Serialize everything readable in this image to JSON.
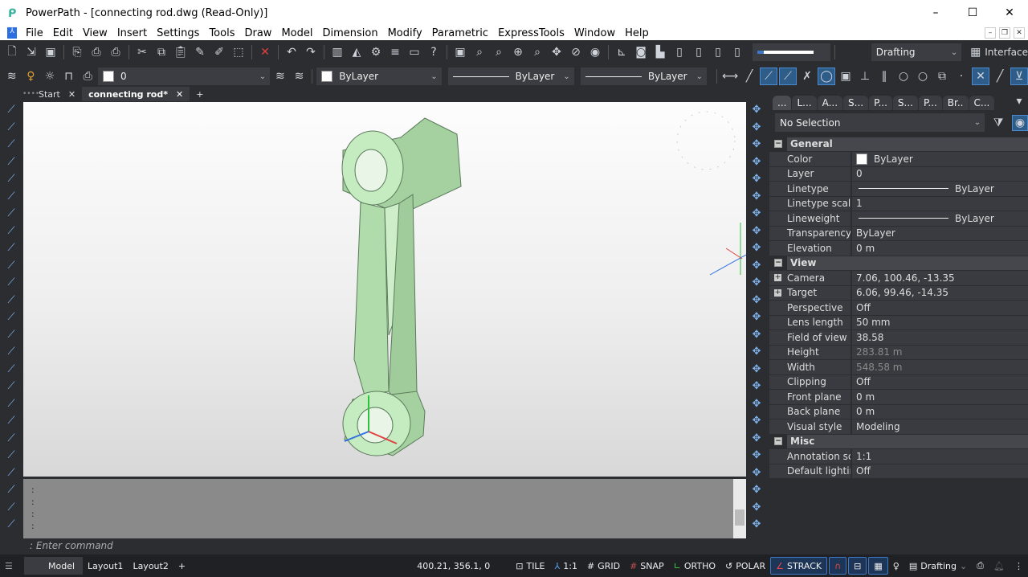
{
  "window": {
    "title": "PowerPath - [connecting rod.dwg (Read-Only)]",
    "minimize": "–",
    "maximize": "☐",
    "close": "✕"
  },
  "menu": [
    "File",
    "Edit",
    "View",
    "Insert",
    "Settings",
    "Tools",
    "Draw",
    "Model",
    "Dimension",
    "Modify",
    "Parametric",
    "ExpressTools",
    "Window",
    "Help"
  ],
  "toolbar1": {
    "icons": [
      "new-icon",
      "open-icon",
      "save-icon",
      "print-preview-icon",
      "plot-icon",
      "batch-plot-icon",
      "cut-icon",
      "copy-icon",
      "paste-icon",
      "match-properties-icon",
      "pick-icon",
      "select-icon",
      "delete-icon",
      "undo-icon",
      "redo-icon",
      "layout-icon",
      "render-icon",
      "settings-icon",
      "layers-icon",
      "image-icon",
      "help-icon",
      "drawing-explorer-icon",
      "zoom-window-icon",
      "zoom-realtime-icon",
      "zoom-extents-icon",
      "zoom-previous-icon",
      "orbit-icon",
      "navigate-icon",
      "visibility-icon",
      "ucs-icon",
      "snapshot-icon",
      "perspective-icon"
    ],
    "workspace": "Drafting",
    "interface_label": "Interface"
  },
  "toolbar2": {
    "layer": "0",
    "color": "ByLayer",
    "linetype": "ByLayer",
    "lineweight": "ByLayer"
  },
  "doc_tabs": [
    {
      "label": "Start",
      "active": false
    },
    {
      "label": "connecting rod*",
      "active": true
    }
  ],
  "props": {
    "tabs": [
      "...",
      "L...",
      "A...",
      "S...",
      "P...",
      "S...",
      "P...",
      "Br..",
      "C..."
    ],
    "selection": "No Selection",
    "sections": [
      {
        "title": "General",
        "rows": [
          [
            "Color",
            "ByLayer"
          ],
          [
            "Layer",
            "0"
          ],
          [
            "Linetype",
            "ByLayer"
          ],
          [
            "Linetype scale",
            "1"
          ],
          [
            "Lineweight",
            "ByLayer"
          ],
          [
            "Transparency",
            "ByLayer"
          ],
          [
            "Elevation",
            "0 m"
          ]
        ]
      },
      {
        "title": "View",
        "rows": [
          [
            "Camera",
            "7.06, 100.46, -13.35"
          ],
          [
            "Target",
            "6.06, 99.46, -14.35"
          ],
          [
            "Perspective",
            "Off"
          ],
          [
            "Lens length",
            "50 mm"
          ],
          [
            "Field of view",
            "38.58"
          ],
          [
            "Height",
            "283.81 m"
          ],
          [
            "Width",
            "548.58 m"
          ],
          [
            "Clipping",
            "Off"
          ],
          [
            "Front plane",
            "0 m"
          ],
          [
            "Back plane",
            "0 m"
          ],
          [
            "Visual style",
            "Modeling"
          ]
        ]
      },
      {
        "title": "Misc",
        "rows": [
          [
            "Annotation sca",
            "1:1"
          ],
          [
            "Default lighting",
            "Off"
          ]
        ]
      }
    ]
  },
  "command": {
    "placeholder": "Enter command",
    "history": [
      ":",
      ":",
      ":",
      ":"
    ]
  },
  "status": {
    "layouts": [
      "Model",
      "Layout1",
      "Layout2"
    ],
    "coords": "400.21, 356.1, 0",
    "tile": "TILE",
    "scale": "1:1",
    "grid": "GRID",
    "snap": "SNAP",
    "ortho": "ORTHO",
    "polar": "POLAR",
    "strack": "STRACK",
    "workspace": "Drafting"
  },
  "colors": {
    "model": "#b8e3b4",
    "accent": "#3c78c8",
    "axis_x": "#e04040",
    "axis_y": "#30c040",
    "axis_z": "#3070e0"
  }
}
